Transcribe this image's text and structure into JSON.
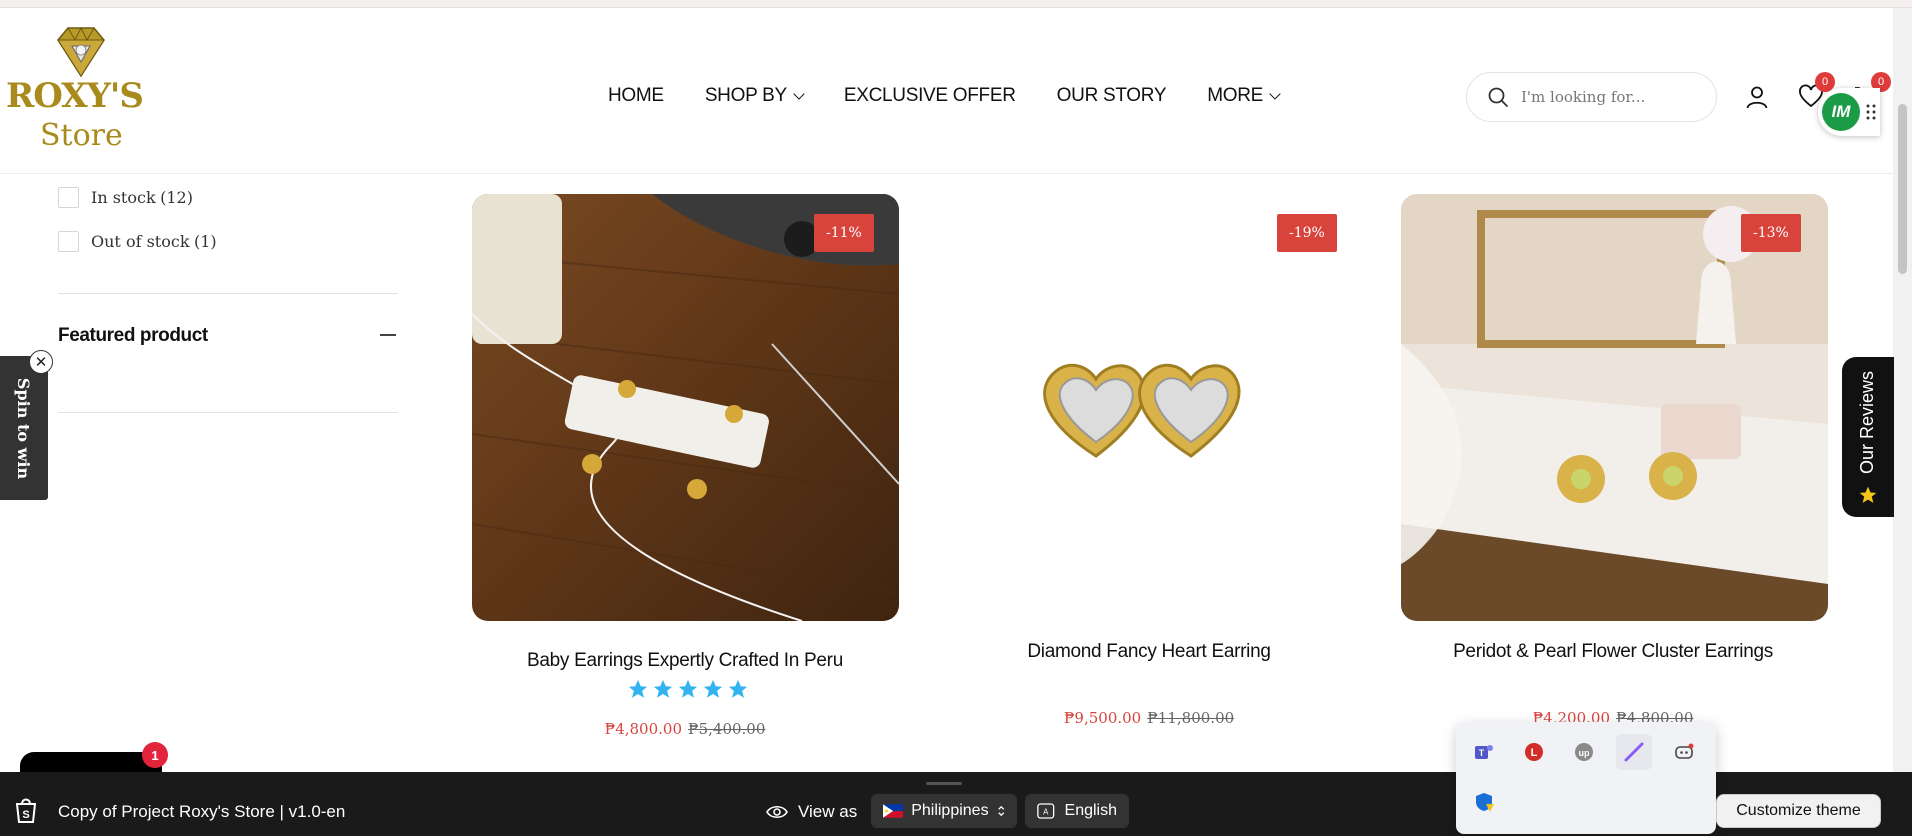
{
  "header": {
    "logo": {
      "line1": "ROXY'S",
      "line2": "Store"
    },
    "nav": [
      {
        "label": "HOME",
        "has_dropdown": false
      },
      {
        "label": "SHOP BY",
        "has_dropdown": true
      },
      {
        "label": "EXCLUSIVE OFFER",
        "has_dropdown": false
      },
      {
        "label": "OUR STORY",
        "has_dropdown": false
      },
      {
        "label": "MORE",
        "has_dropdown": true
      }
    ],
    "search": {
      "placeholder": "I'm looking for...",
      "icon": "search-icon"
    },
    "wishlist_count": "0",
    "cart_count": "0",
    "widget_label": "IM"
  },
  "sidebar": {
    "availability": [
      {
        "label": "In stock",
        "count": "(12)"
      },
      {
        "label": "Out of stock",
        "count": "(1)"
      }
    ],
    "featured_title": "Featured product"
  },
  "spin_tab": {
    "label": "Spin to win",
    "close": "✕"
  },
  "products": [
    {
      "title": "Baby Earrings Expertly Crafted In Peru",
      "discount": "-11%",
      "sale_price": "₱4,800.00",
      "old_price": "₱5,400.00",
      "rating": 5
    },
    {
      "title": "Diamond Fancy Heart Earring",
      "discount": "-19%",
      "sale_price": "₱9,500.00",
      "old_price": "₱11,800.00"
    },
    {
      "title": "Peridot & Pearl Flower Cluster Earrings",
      "discount": "-13%",
      "sale_price": "₱4,200.00",
      "old_price": "₱4,800.00"
    }
  ],
  "reviews_tab": {
    "label": "Our Reviews"
  },
  "chat": {
    "badge": "1"
  },
  "bottom_bar": {
    "store_label": "Copy of Project Roxy's Store | v1.0-en",
    "view_as": "View as",
    "country": "Philippines",
    "language": "English",
    "customize": "Customize theme"
  },
  "colors": {
    "brand_gold": "#a88a1d",
    "sale_red": "#d8443c",
    "star_blue": "#33b3ef",
    "bar_dark": "#1a1a1a"
  }
}
